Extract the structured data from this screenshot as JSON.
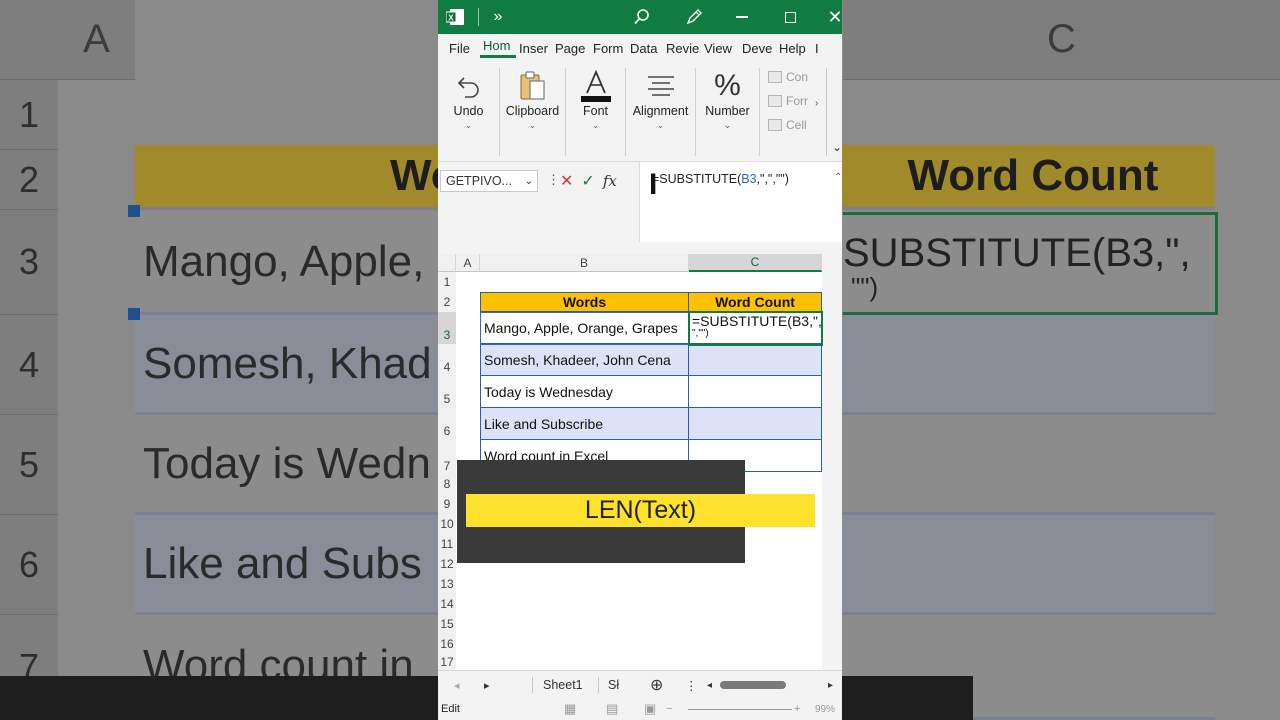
{
  "background": {
    "col_a": "A",
    "col_c": "C",
    "row_labels": [
      "1",
      "2",
      "3",
      "4",
      "5",
      "6",
      "7"
    ],
    "header_text": "Word Count",
    "header_left_partial": "Wo",
    "cells": [
      "Mango, Apple,",
      "Somesh, Khad",
      "Today is Wedn",
      "Like and Subs",
      "Word count in"
    ],
    "right_formula_line1": "SUBSTITUTE(B3,\",",
    "right_formula_line2": "\"\")"
  },
  "title_bar": {
    "app_icon": "excel-icon",
    "more": "»",
    "icons": [
      "search-icon",
      "pen-icon",
      "minimize-icon",
      "maximize-icon",
      "close-icon"
    ]
  },
  "menu": [
    "File",
    "Hom",
    "Inser",
    "Page",
    "Form",
    "Data",
    "Revie",
    "View",
    "Deve",
    "Help",
    "I"
  ],
  "ribbon": {
    "groups": [
      {
        "label": "Undo",
        "icon": "undo-icon"
      },
      {
        "label": "Clipboard",
        "icon": "clipboard-icon"
      },
      {
        "label": "Font",
        "icon": "font-icon"
      },
      {
        "label": "Alignment",
        "icon": "alignment-icon"
      },
      {
        "label": "Number",
        "icon": "percent-icon"
      }
    ],
    "styles": [
      "Con",
      "Forr",
      "Cell"
    ]
  },
  "formula_bar": {
    "name_box": "GETPIVO...",
    "formula_prefix": "=SUBSTITUTE(",
    "formula_ref": "B3",
    "formula_suffix": ",\",\",\"\")"
  },
  "grid": {
    "columns": [
      "A",
      "B",
      "C"
    ],
    "rows": [
      "1",
      "2",
      "3",
      "4",
      "5",
      "6",
      "7",
      "8",
      "9",
      "10",
      "11",
      "12",
      "13",
      "14",
      "15",
      "16",
      "17"
    ],
    "header": {
      "words": "Words",
      "count": "Word Count"
    },
    "data": [
      {
        "words": "Mango, Apple, Orange, Grapes",
        "count": "=SUBSTITUTE(B3,\","
      },
      {
        "words": "Somesh, Khadeer, John Cena",
        "count": ""
      },
      {
        "words": "Today is Wednesday",
        "count": ""
      },
      {
        "words": "Like and Subscribe",
        "count": ""
      },
      {
        "words": "Word count in Excel",
        "count": ""
      }
    ],
    "active_cell_line2": "\",\"\")"
  },
  "caption": "LEN(Text)",
  "sheet_tabs": {
    "sheet1": "Sheet1",
    "sheet2": "Sł"
  },
  "status": {
    "mode": "Edit",
    "zoom": "99%"
  }
}
